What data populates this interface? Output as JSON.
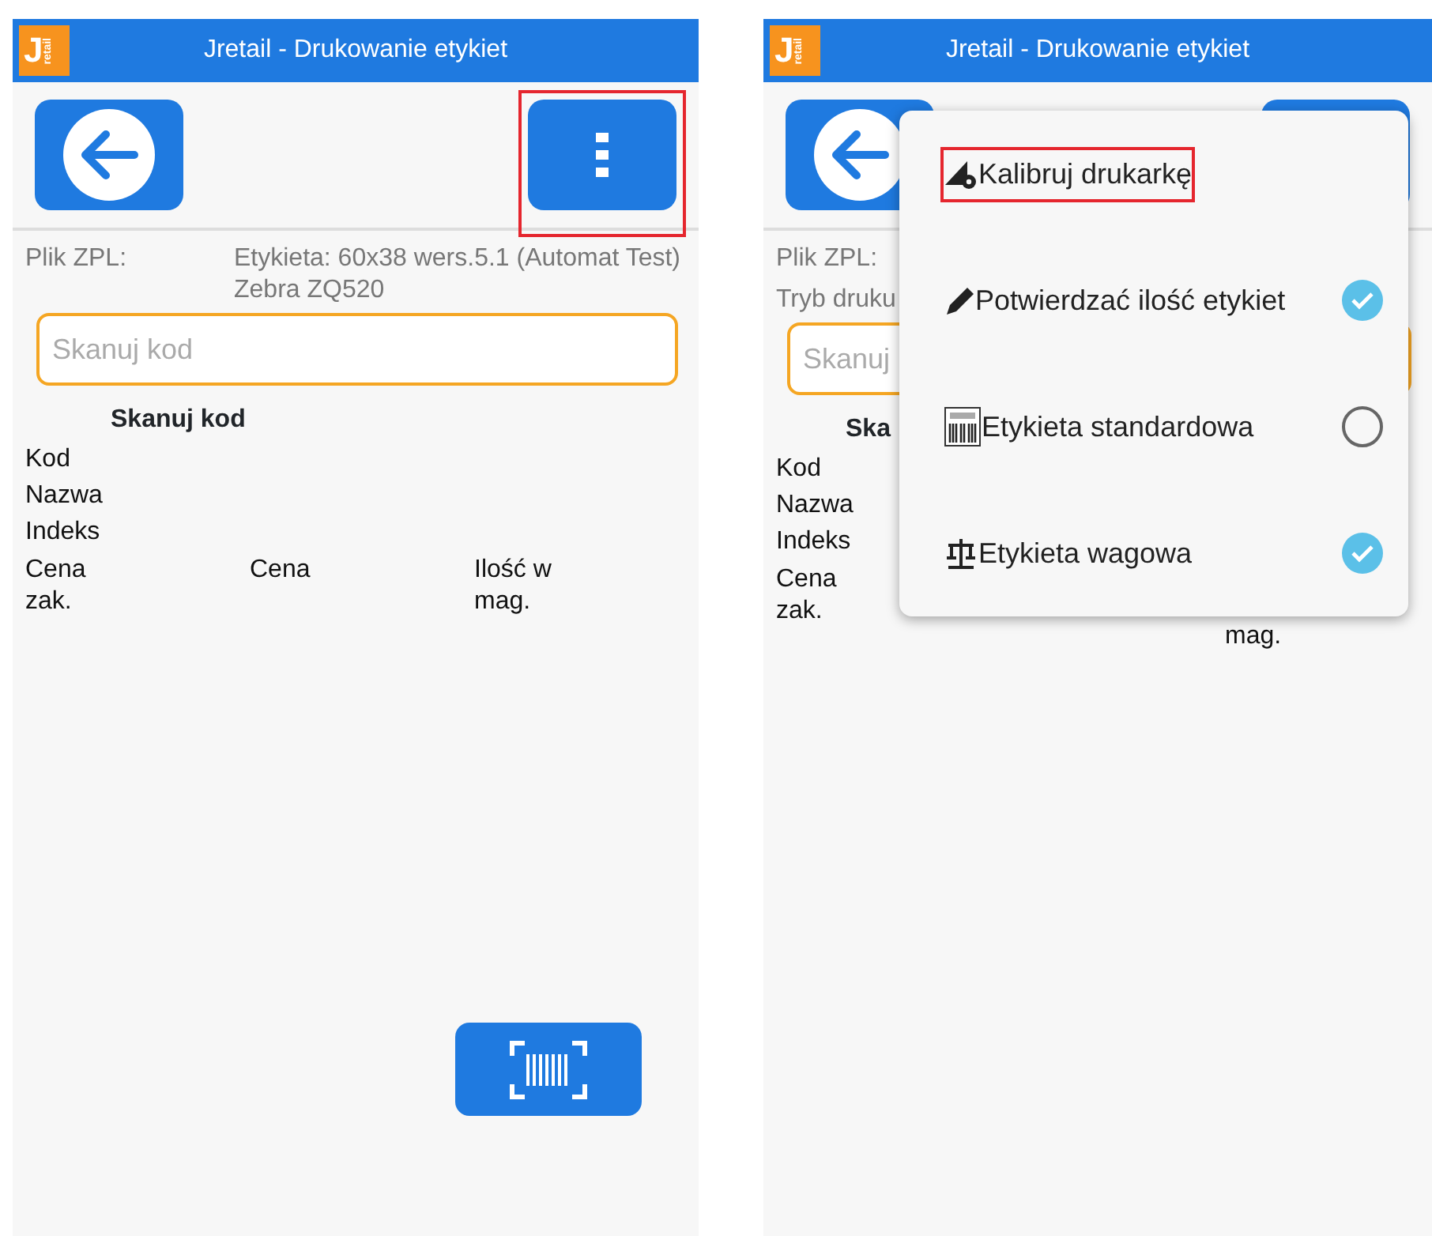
{
  "screens": [
    {
      "title": "Jretail - Drukowanie etykiet",
      "logo": {
        "letter": "J",
        "word": "retail"
      },
      "menu_button": {
        "highlighted": true
      },
      "info": [
        {
          "label": "Plik ZPL:",
          "value": "Etykieta: 60x38 wers.5.1 (Automat Test) Zebra ZQ520"
        }
      ],
      "scan_field": {
        "placeholder": "Skanuj kod"
      },
      "section_title": "Skanuj kod",
      "fields": [
        "Kod",
        "Nazwa",
        "Indeks"
      ],
      "price_row": [
        {
          "kind": "purchase",
          "text": "Cena zak."
        },
        {
          "kind": "sale",
          "text": "Cena"
        },
        {
          "kind": "stock",
          "text": "Ilość w mag."
        }
      ],
      "scan_button": {
        "visible": true
      }
    },
    {
      "title": "Jretail - Drukowanie etykiet",
      "logo": {
        "letter": "J",
        "word": "retail"
      },
      "info": [
        {
          "label": "Plik ZPL:"
        },
        {
          "label": "Tryb druku"
        }
      ],
      "scan_field": {
        "placeholder": "Skanuj"
      },
      "section_title": "Ska",
      "fields": [
        "Kod",
        "Nazwa",
        "Indeks"
      ],
      "price_row": [
        {
          "kind": "purchase",
          "text": "Cena zak."
        },
        {
          "kind": "stock",
          "text": "mag."
        }
      ],
      "menu": [
        {
          "kind": "action",
          "text": "Kalibruj drukarkę",
          "highlighted": true
        },
        {
          "kind": "toggle",
          "text": "Potwierdzać ilość etykiet",
          "highlighted": false,
          "checked": true
        },
        {
          "kind": "toggle",
          "text": "Etykieta standardowa",
          "highlighted": false,
          "checked": false
        },
        {
          "kind": "toggle",
          "text": "Etykieta wagowa",
          "highlighted": false,
          "checked": true
        }
      ]
    }
  ]
}
